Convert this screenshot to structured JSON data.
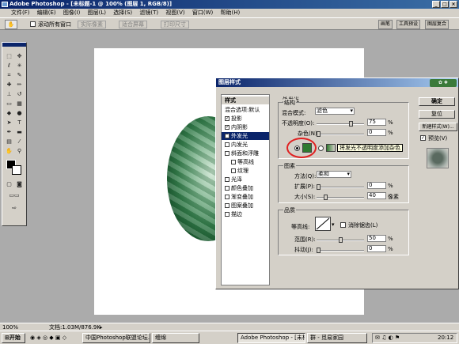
{
  "app": {
    "title": "Adobe Photoshop - [未标题-1 @ 100% (图层 1, RGB/8)]"
  },
  "menu": [
    "文件(F)",
    "编辑(E)",
    "图像(I)",
    "图层(L)",
    "选择(S)",
    "滤镜(T)",
    "视图(V)",
    "窗口(W)",
    "帮助(H)"
  ],
  "options": {
    "scroll_all": "滚动所有窗口",
    "actual_pixels": "实际像素",
    "fit_screen": "适合屏幕",
    "print_size": "打印尺寸",
    "wells": [
      "画笔",
      "工具预设",
      "图层复合"
    ]
  },
  "dialog": {
    "title": "图层样式",
    "styles_header": "样式",
    "styles": [
      {
        "label": "混合选项:默认",
        "checked": false,
        "indent": false,
        "selected": false
      },
      {
        "label": "投影",
        "checked": true,
        "indent": false,
        "selected": false
      },
      {
        "label": "内阴影",
        "checked": true,
        "indent": false,
        "selected": false
      },
      {
        "label": "外发光",
        "checked": true,
        "indent": false,
        "selected": true
      },
      {
        "label": "内发光",
        "checked": false,
        "indent": false,
        "selected": false
      },
      {
        "label": "斜面和浮雕",
        "checked": false,
        "indent": false,
        "selected": false
      },
      {
        "label": "等高线",
        "checked": false,
        "indent": true,
        "selected": false
      },
      {
        "label": "纹理",
        "checked": false,
        "indent": true,
        "selected": false
      },
      {
        "label": "光泽",
        "checked": false,
        "indent": false,
        "selected": false
      },
      {
        "label": "颜色叠加",
        "checked": false,
        "indent": false,
        "selected": false
      },
      {
        "label": "渐变叠加",
        "checked": false,
        "indent": false,
        "selected": false
      },
      {
        "label": "图案叠加",
        "checked": false,
        "indent": false,
        "selected": false
      },
      {
        "label": "描边",
        "checked": false,
        "indent": false,
        "selected": false
      }
    ],
    "section_title": "外发光",
    "structure": {
      "title": "结构",
      "blend_label": "混合模式:",
      "blend_value": "滤色",
      "opacity_label": "不透明度(O):",
      "opacity_value": "75",
      "noise_label": "杂色(N):",
      "noise_value": "0",
      "pct": "%",
      "glow_color": "#2f7a2f",
      "tooltip": "将发光不透明度添加杂色",
      "opacity_level": 0.75,
      "noise_level": 0.0
    },
    "elements": {
      "title": "图素",
      "method_label": "方法(Q):",
      "method_value": "柔和",
      "spread_label": "扩展(P):",
      "spread_value": "0",
      "size_label": "大小(S):",
      "size_value": "40",
      "unit_px": "像素",
      "spread_level": 0.0,
      "size_level": 0.16
    },
    "quality": {
      "title": "品质",
      "contour_label": "等高线:",
      "antialias_label": "消除锯齿(L)",
      "range_label": "范围(R):",
      "range_value": "50",
      "jitter_label": "抖动(J):",
      "jitter_value": "0",
      "range_level": 0.5,
      "jitter_level": 0.0
    },
    "buttons": {
      "ok": "确定",
      "cancel": "复位",
      "new_style": "新建样式(W)...",
      "preview": "预览(V)"
    }
  },
  "status": {
    "zoom": "100%",
    "doc": "文档:1.03M/876.9K"
  },
  "taskbar": {
    "start": "开始",
    "items": [
      "中国Photoshop联盟论坛...",
      "缠绵",
      "Adobe Photoshop - [未标...",
      "群 - 觅易家园"
    ],
    "clock": "20:12"
  }
}
